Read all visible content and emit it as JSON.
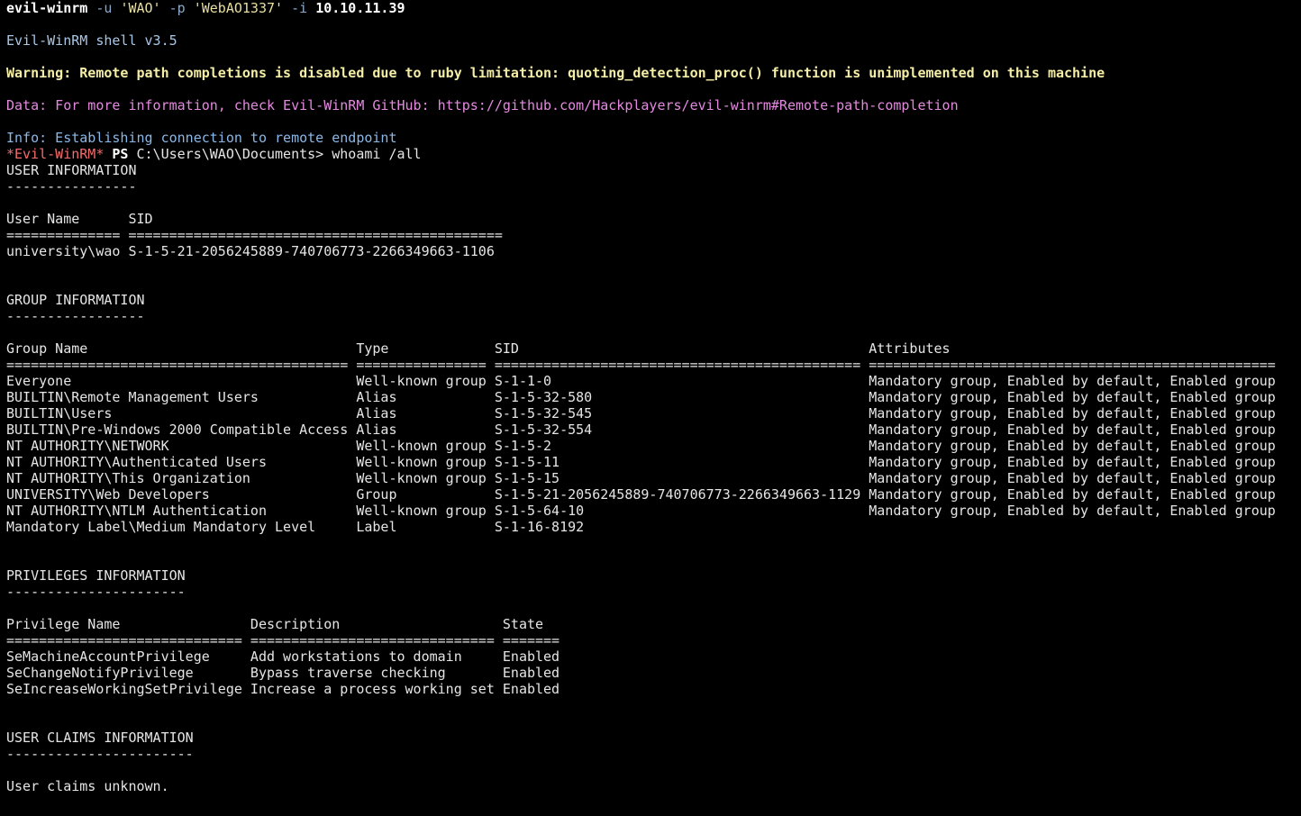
{
  "command": {
    "program": "evil-winrm",
    "flag_user": "-u",
    "user": "'WAO'",
    "flag_pass": "-p",
    "password": "'WebAO1337'",
    "flag_ip": "-i",
    "ip": "10.10.11.39"
  },
  "banner": "Evil-WinRM shell v3.5",
  "warning": "Warning: Remote path completions is disabled due to ruby limitation: quoting_detection_proc() function is unimplemented on this machine",
  "data_msg": "Data: For more information, check Evil-WinRM GitHub: https://github.com/Hackplayers/evil-winrm#Remote-path-completion",
  "info_msg": "Info: Establishing connection to remote endpoint",
  "prompt": {
    "tag": "*Evil-WinRM*",
    "ps": "PS",
    "path": "C:\\Users\\WAO\\Documents>",
    "input": "whoami /all"
  },
  "output_lines": [
    "USER INFORMATION",
    "----------------",
    "",
    "User Name      SID",
    "============== ==============================================",
    "university\\wao S-1-5-21-2056245889-740706773-2266349663-1106",
    "",
    "",
    "GROUP INFORMATION",
    "-----------------",
    "",
    "Group Name                                 Type             SID                                           Attributes",
    "========================================== ================ ============================================= ==================================================",
    "Everyone                                   Well-known group S-1-1-0                                       Mandatory group, Enabled by default, Enabled group",
    "BUILTIN\\Remote Management Users            Alias            S-1-5-32-580                                  Mandatory group, Enabled by default, Enabled group",
    "BUILTIN\\Users                              Alias            S-1-5-32-545                                  Mandatory group, Enabled by default, Enabled group",
    "BUILTIN\\Pre-Windows 2000 Compatible Access Alias            S-1-5-32-554                                  Mandatory group, Enabled by default, Enabled group",
    "NT AUTHORITY\\NETWORK                       Well-known group S-1-5-2                                       Mandatory group, Enabled by default, Enabled group",
    "NT AUTHORITY\\Authenticated Users           Well-known group S-1-5-11                                      Mandatory group, Enabled by default, Enabled group",
    "NT AUTHORITY\\This Organization             Well-known group S-1-5-15                                      Mandatory group, Enabled by default, Enabled group",
    "UNIVERSITY\\Web Developers                  Group            S-1-5-21-2056245889-740706773-2266349663-1129 Mandatory group, Enabled by default, Enabled group",
    "NT AUTHORITY\\NTLM Authentication           Well-known group S-1-5-64-10                                   Mandatory group, Enabled by default, Enabled group",
    "Mandatory Label\\Medium Mandatory Level     Label            S-1-16-8192",
    "",
    "",
    "PRIVILEGES INFORMATION",
    "----------------------",
    "",
    "Privilege Name                Description                    State",
    "============================= ============================== =======",
    "SeMachineAccountPrivilege     Add workstations to domain     Enabled",
    "SeChangeNotifyPrivilege       Bypass traverse checking       Enabled",
    "SeIncreaseWorkingSetPrivilege Increase a process working set Enabled",
    "",
    "",
    "USER CLAIMS INFORMATION",
    "-----------------------",
    "",
    "User claims unknown."
  ],
  "colors": {
    "background": "#000000",
    "prompt_tag": "#f26d6d",
    "warning": "#f4eea6",
    "data": "#e489e0",
    "info": "#8ab8e8"
  }
}
